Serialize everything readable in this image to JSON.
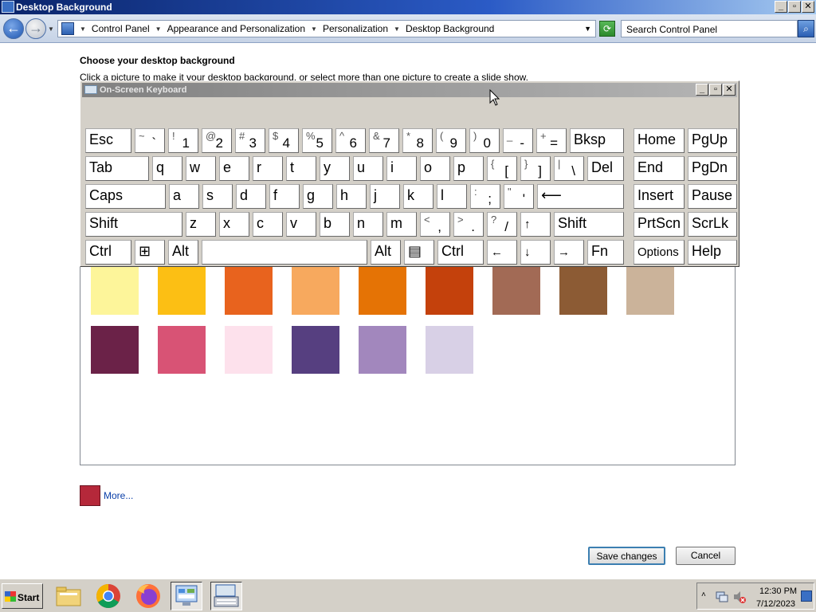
{
  "window": {
    "title": "Desktop Background",
    "controls": [
      "_",
      "▫",
      "✕"
    ]
  },
  "address": {
    "crumbs": [
      "Control Panel",
      "Appearance and Personalization",
      "Personalization",
      "Desktop Background"
    ],
    "search_placeholder": "Search Control Panel"
  },
  "content": {
    "heading": "Choose your desktop background",
    "subtext": "Click a picture to make it your desktop background, or select more than one picture to create a slide show.",
    "swatches": [
      [
        "#fdf59a",
        "#fcbf14",
        "#e8631e",
        "#f7a95e",
        "#e57305",
        "#c4410c",
        "#a26a55",
        "#8c5b34",
        "#cbb39a"
      ],
      [
        "#6b2248",
        "#d85375",
        "#fde1ec",
        "#563f80",
        "#a287bd",
        "#d8d0e6"
      ]
    ],
    "more_color": "#b5283a",
    "more_label": "More...",
    "save_label": "Save changes",
    "cancel_label": "Cancel"
  },
  "osk": {
    "title": "On-Screen Keyboard",
    "rows": [
      [
        {
          "main": "Esc",
          "w": 58
        },
        {
          "shift": "~",
          "un": "`",
          "w": 38
        },
        {
          "shift": "!",
          "un": "1",
          "w": 38
        },
        {
          "shift": "@",
          "un": "2",
          "w": 38
        },
        {
          "shift": "#",
          "un": "3",
          "w": 38
        },
        {
          "shift": "$",
          "un": "4",
          "w": 38
        },
        {
          "shift": "%",
          "un": "5",
          "w": 38
        },
        {
          "shift": "^",
          "un": "6",
          "w": 38
        },
        {
          "shift": "&",
          "un": "7",
          "w": 38
        },
        {
          "shift": "*",
          "un": "8",
          "w": 38
        },
        {
          "shift": "(",
          "un": "9",
          "w": 38
        },
        {
          "shift": ")",
          "un": "0",
          "w": 38
        },
        {
          "shift": "_",
          "un": "-",
          "w": 38
        },
        {
          "shift": "+",
          "un": "=",
          "w": 38
        },
        {
          "main": "Bksp",
          "w": 68,
          "gap": 0
        },
        {
          "main": "Home",
          "w": 64,
          "gap": 8
        },
        {
          "main": "PgUp",
          "w": 62
        }
      ],
      [
        {
          "main": "Tab",
          "w": 80
        },
        {
          "main": "q",
          "w": 38
        },
        {
          "main": "w",
          "w": 38
        },
        {
          "main": "e",
          "w": 38
        },
        {
          "main": "r",
          "w": 38
        },
        {
          "main": "t",
          "w": 38
        },
        {
          "main": "y",
          "w": 38
        },
        {
          "main": "u",
          "w": 38
        },
        {
          "main": "i",
          "w": 38
        },
        {
          "main": "o",
          "w": 38
        },
        {
          "main": "p",
          "w": 38
        },
        {
          "shift": "{",
          "un": "[",
          "w": 38
        },
        {
          "shift": "}",
          "un": "]",
          "w": 38
        },
        {
          "shift": "|",
          "un": "\\",
          "w": 38
        },
        {
          "main": "Del",
          "w": 46
        },
        {
          "main": "End",
          "w": 64,
          "gap": 8
        },
        {
          "main": "PgDn",
          "w": 62
        }
      ],
      [
        {
          "main": "Caps",
          "w": 101
        },
        {
          "main": "a",
          "w": 38
        },
        {
          "main": "s",
          "w": 38
        },
        {
          "main": "d",
          "w": 38
        },
        {
          "main": "f",
          "w": 38
        },
        {
          "main": "g",
          "w": 38
        },
        {
          "main": "h",
          "w": 38
        },
        {
          "main": "j",
          "w": 38
        },
        {
          "main": "k",
          "w": 38
        },
        {
          "main": "l",
          "w": 38
        },
        {
          "shift": ":",
          "un": ";",
          "w": 38
        },
        {
          "shift": "\"",
          "un": "'",
          "w": 38
        },
        {
          "main": "⟵",
          "w": 109
        },
        {
          "main": "Insert",
          "w": 64,
          "gap": 8
        },
        {
          "main": "Pause",
          "w": 62
        }
      ],
      [
        {
          "main": "Shift",
          "w": 122
        },
        {
          "main": "z",
          "w": 38
        },
        {
          "main": "x",
          "w": 38
        },
        {
          "main": "c",
          "w": 38
        },
        {
          "main": "v",
          "w": 38
        },
        {
          "main": "b",
          "w": 38
        },
        {
          "main": "n",
          "w": 38
        },
        {
          "main": "m",
          "w": 38
        },
        {
          "shift": "<",
          "un": ",",
          "w": 38
        },
        {
          "shift": ">",
          "un": ".",
          "w": 38
        },
        {
          "shift": "?",
          "un": "/",
          "w": 38
        },
        {
          "main": "↑",
          "w": 38,
          "small": true
        },
        {
          "main": "Shift",
          "w": 88
        },
        {
          "main": "PrtScn",
          "w": 64,
          "gap": 8
        },
        {
          "main": "ScrLk",
          "w": 62
        }
      ],
      [
        {
          "main": "Ctrl",
          "w": 58
        },
        {
          "main": "⊞",
          "w": 38,
          "icon": "windows-logo-icon"
        },
        {
          "main": "Alt",
          "w": 38
        },
        {
          "main": "",
          "w": 208
        },
        {
          "main": "Alt",
          "w": 38
        },
        {
          "main": "▤",
          "w": 38,
          "icon": "menu-key-icon"
        },
        {
          "main": "Ctrl",
          "w": 58
        },
        {
          "main": "←",
          "w": 38,
          "small": true
        },
        {
          "main": "↓",
          "w": 38,
          "small": true
        },
        {
          "main": "→",
          "w": 38,
          "small": true
        },
        {
          "main": "Fn",
          "w": 46
        },
        {
          "main": "Options",
          "w": 64,
          "gap": 8,
          "small": true
        },
        {
          "main": "Help",
          "w": 62
        }
      ]
    ]
  },
  "taskbar": {
    "start_label": "Start",
    "time": "12:30 PM",
    "date": "7/12/2023"
  }
}
